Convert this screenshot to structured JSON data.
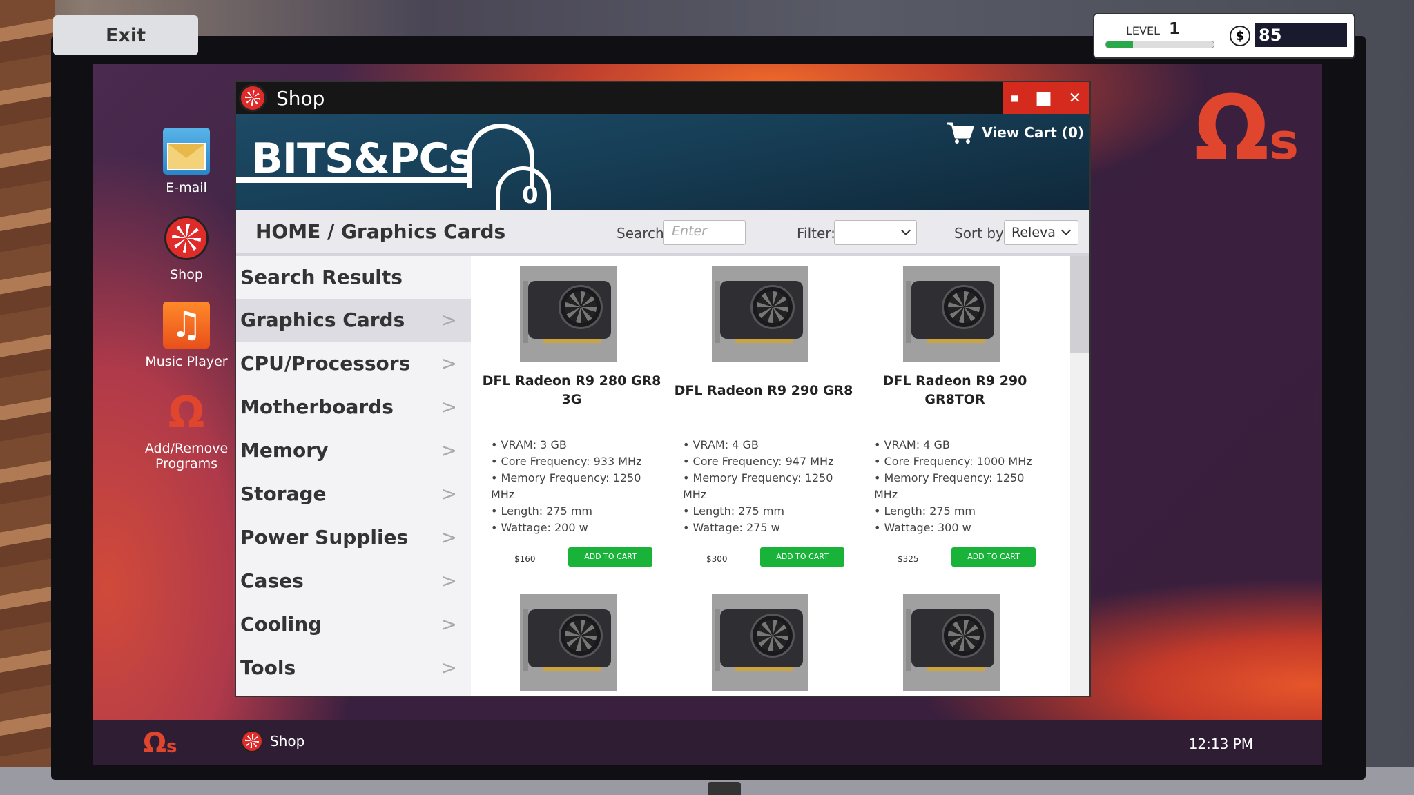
{
  "hud": {
    "exit_label": "Exit",
    "level_label": "LEVEL",
    "level": "1",
    "xp_fraction": 0.25,
    "currency_symbol": "$",
    "money": "85"
  },
  "desktop": {
    "icons": [
      {
        "label": "E-mail",
        "icon": "email-icon"
      },
      {
        "label": "Shop",
        "icon": "fan-icon"
      },
      {
        "label": "Music Player",
        "icon": "music-note-icon"
      },
      {
        "label": "Add/Remove Programs",
        "icon": "omega-icon"
      }
    ],
    "os_logo_main": "Ω",
    "os_logo_sub": "s"
  },
  "taskbar": {
    "app_label": "Shop",
    "clock": "12:13 PM"
  },
  "window": {
    "title": "Shop",
    "controls": {
      "minimize": "■",
      "maximize": "■",
      "close": "✕"
    },
    "brand": "BITS&PCs",
    "cart_badge": "0",
    "view_cart": "View Cart (0)",
    "breadcrumb": "HOME / Graphics Cards",
    "search_label": "Search:",
    "search_placeholder": "Enter",
    "filter_label": "Filter:",
    "sort_label": "Sort by:",
    "sort_value": "Releva",
    "categories": [
      {
        "label": "Search Results",
        "arrow": ""
      },
      {
        "label": "Graphics Cards",
        "arrow": ">"
      },
      {
        "label": "CPU/Processors",
        "arrow": ">"
      },
      {
        "label": "Motherboards",
        "arrow": ">"
      },
      {
        "label": "Memory",
        "arrow": ">"
      },
      {
        "label": "Storage",
        "arrow": ">"
      },
      {
        "label": "Power Supplies",
        "arrow": ">"
      },
      {
        "label": "Cases",
        "arrow": ">"
      },
      {
        "label": "Cooling",
        "arrow": ">"
      },
      {
        "label": "Tools",
        "arrow": ">"
      }
    ],
    "active_category": "Graphics Cards",
    "add_to_cart_label": "ADD TO CART",
    "products": [
      {
        "name": "DFL Radeon R9 280 GR8 3G",
        "specs": [
          "VRAM: 3 GB",
          "Core Frequency: 933 MHz",
          "Memory Frequency: 1250 MHz",
          "Length: 275 mm",
          "Wattage: 200 w"
        ],
        "price": "$160"
      },
      {
        "name": "DFL Radeon R9 290 GR8",
        "specs": [
          "VRAM: 4 GB",
          "Core Frequency: 947 MHz",
          "Memory Frequency: 1250 MHz",
          "Length: 275 mm",
          "Wattage: 275 w"
        ],
        "price": "$300"
      },
      {
        "name": "DFL Radeon R9 290 GR8TOR",
        "specs": [
          "VRAM: 4 GB",
          "Core Frequency: 1000 MHz",
          "Memory Frequency: 1250 MHz",
          "Length: 275 mm",
          "Wattage: 300 w"
        ],
        "price": "$325"
      }
    ]
  }
}
